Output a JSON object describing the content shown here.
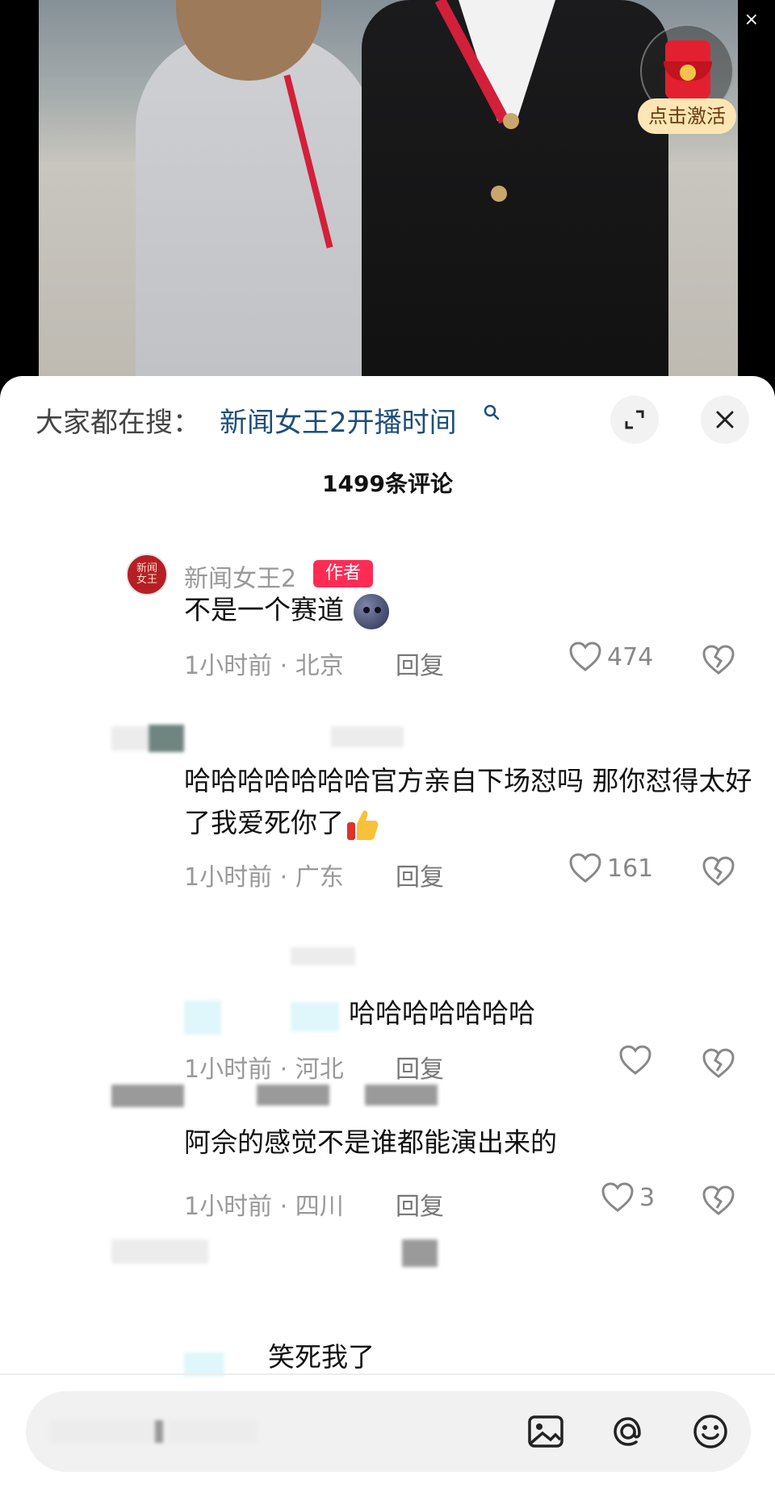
{
  "video": {
    "close_glyph": "×",
    "redpacket_label": "点击激活"
  },
  "sheet": {
    "search_prefix": "大家都在搜：",
    "search_link": "新闻女王2开播时间",
    "comment_count": "1499条评论",
    "comments": [
      {
        "author": "新闻女王2",
        "badge": "作者",
        "text": "不是一个赛道",
        "time_location": "1小时前 · 北京",
        "reply": "回复",
        "likes": "474"
      },
      {
        "text": "哈哈哈哈哈哈哈官方亲自下场怼吗 那你怼得太好了我爱死你了",
        "time_location": "1小时前 · 广东",
        "reply": "回复",
        "likes": "161"
      },
      {
        "text": "哈哈哈哈哈哈哈",
        "time_location": "1小时前 · 河北",
        "reply": "回复",
        "likes": ""
      },
      {
        "text": "阿佘的感觉不是谁都能演出来的",
        "time_location": "1小时前 · 四川",
        "reply": "回复",
        "likes": "3"
      },
      {
        "text": "笑死我了"
      }
    ]
  },
  "input_bar": {
    "icons": [
      "image-icon",
      "at-icon",
      "emoji-icon"
    ]
  }
}
